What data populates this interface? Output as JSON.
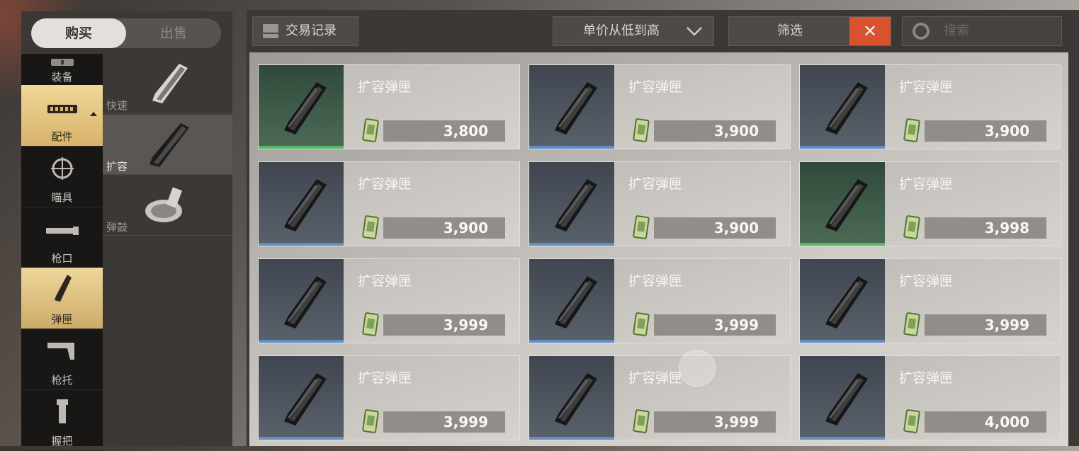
{
  "tabs": {
    "buy": "购买",
    "sell": "出售"
  },
  "categories": [
    {
      "label": "装备",
      "icon": "armor-icon"
    },
    {
      "label": "配件",
      "icon": "attachment-icon",
      "selected": true
    },
    {
      "label": "瞄具",
      "icon": "scope-icon"
    },
    {
      "label": "枪口",
      "icon": "muzzle-icon"
    },
    {
      "label": "弹匣",
      "icon": "magazine-icon",
      "selected": true
    },
    {
      "label": "枪托",
      "icon": "stock-icon"
    },
    {
      "label": "握把",
      "icon": "grip-icon"
    }
  ],
  "subcategories": [
    {
      "label": "快速",
      "icon": "quick-mag-icon"
    },
    {
      "label": "扩容",
      "icon": "extended-mag-icon",
      "selected": true
    },
    {
      "label": "弹鼓",
      "icon": "drum-mag-icon"
    }
  ],
  "toolbar": {
    "history": "交易记录",
    "sort": "单价从低到高",
    "filter": "筛选",
    "close": "✕",
    "search_placeholder": "搜索"
  },
  "listings": [
    {
      "name": "扩容弹匣",
      "price": "3,800",
      "rarity": "green"
    },
    {
      "name": "扩容弹匣",
      "price": "3,900",
      "rarity": "blue"
    },
    {
      "name": "扩容弹匣",
      "price": "3,900",
      "rarity": "blue"
    },
    {
      "name": "扩容弹匣",
      "price": "3,900",
      "rarity": "blue"
    },
    {
      "name": "扩容弹匣",
      "price": "3,900",
      "rarity": "blue"
    },
    {
      "name": "扩容弹匣",
      "price": "3,998",
      "rarity": "green"
    },
    {
      "name": "扩容弹匣",
      "price": "3,999",
      "rarity": "blue"
    },
    {
      "name": "扩容弹匣",
      "price": "3,999",
      "rarity": "blue"
    },
    {
      "name": "扩容弹匣",
      "price": "3,999",
      "rarity": "blue"
    },
    {
      "name": "扩容弹匣",
      "price": "3,999",
      "rarity": "blue"
    },
    {
      "name": "扩容弹匣",
      "price": "3,999",
      "rarity": "blue"
    },
    {
      "name": "扩容弹匣",
      "price": "4,000",
      "rarity": "blue"
    }
  ],
  "colors": {
    "accent_gold": "#e3c37d",
    "close_red": "#d8532d",
    "rarity_blue": "#5f8fc7",
    "rarity_green": "#59b766"
  }
}
